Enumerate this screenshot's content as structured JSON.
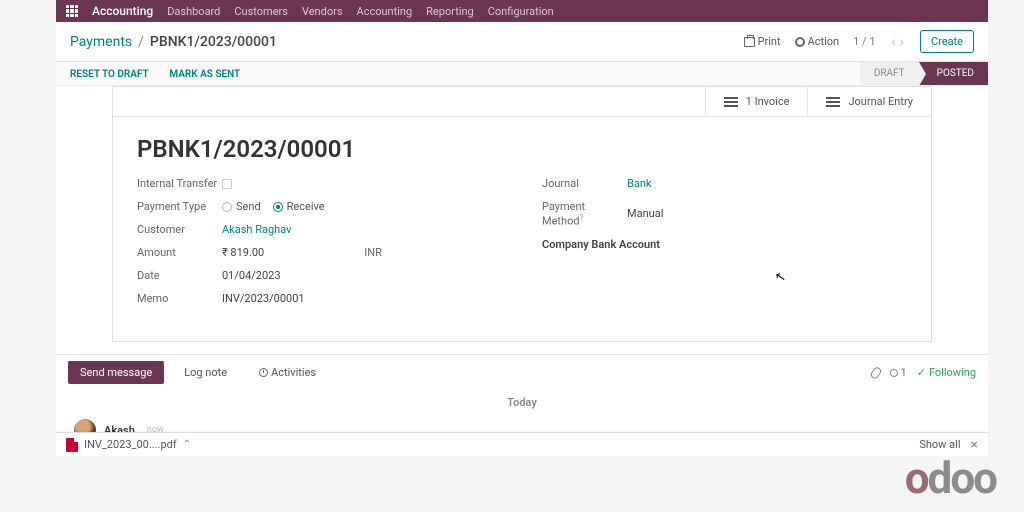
{
  "menubar": {
    "app": "Accounting",
    "items": [
      "Dashboard",
      "Customers",
      "Vendors",
      "Accounting",
      "Reporting",
      "Configuration"
    ]
  },
  "breadcrumb": {
    "parent": "Payments",
    "current": "PBNK1/2023/00001"
  },
  "controls": {
    "print": "Print",
    "action": "Action",
    "pager": "1 / 1",
    "create": "Create"
  },
  "statusbar": {
    "reset": "RESET TO DRAFT",
    "mark_sent": "MARK AS SENT",
    "draft": "DRAFT",
    "posted": "POSTED"
  },
  "smart": {
    "invoice": "1 Invoice",
    "journal_entry": "Journal Entry"
  },
  "record": {
    "title": "PBNK1/2023/00001",
    "labels": {
      "internal_transfer": "Internal Transfer",
      "payment_type": "Payment Type",
      "send": "Send",
      "receive": "Receive",
      "customer": "Customer",
      "amount": "Amount",
      "date": "Date",
      "memo": "Memo",
      "journal": "Journal",
      "payment_method": "Payment Method",
      "company_bank": "Company Bank Account"
    },
    "values": {
      "customer": "Akash Raghav",
      "amount": "₹ 819.00",
      "currency": "INR",
      "date": "01/04/2023",
      "memo": "INV/2023/00001",
      "journal": "Bank",
      "payment_method": "Manual"
    }
  },
  "chatter": {
    "send_message": "Send message",
    "log_note": "Log note",
    "activities": "Activities",
    "follower_count": "1",
    "following": "Following",
    "today": "Today",
    "author": "Akash",
    "time": "now"
  },
  "download": {
    "file": "INV_2023_00....pdf",
    "show_all": "Show all"
  },
  "logo": "odoo"
}
